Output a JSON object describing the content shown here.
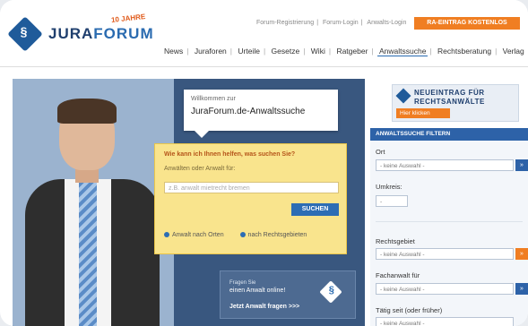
{
  "header": {
    "logo_text_a": "JURA",
    "logo_text_b": "FORUM",
    "logo_mark": "§",
    "logo_badge": "10 JAHRE",
    "top_links": [
      "Forum-Registrierung",
      "Forum-Login",
      "Anwalts-Login"
    ],
    "ra_button": "RA-EINTRAG KOSTENLOS TESTEN",
    "nav": [
      "News",
      "Juraforen",
      "Urteile",
      "Gesetze",
      "Wiki",
      "Ratgeber",
      "Anwaltssuche",
      "Rechtsberatung",
      "Verlag"
    ],
    "nav_active": "Anwaltssuche"
  },
  "hero": {
    "welcome_small": "Willkommen zur",
    "welcome_title": "JuraForum.de-Anwaltssuche",
    "search": {
      "question": "Wie kann ich Ihnen helfen, was suchen Sie?",
      "label": "Anwälten oder Anwalt für:",
      "placeholder": "z.B. anwalt mietrecht bremen",
      "button": "SUCHEN",
      "radio1": "Anwalt nach Orten",
      "radio2": "nach Rechtsgebieten"
    },
    "promo": {
      "line1": "Fragen Sie",
      "line2": "einen Anwalt online!",
      "link": "Jetzt Anwalt fragen >>>"
    }
  },
  "sidebar": {
    "banner_line1": "NEUEINTRAG FÜR",
    "banner_line2": "RECHTSANWÄLTE",
    "banner_button": "Hier klicken",
    "filter_title": "ANWALTSSUCHE FILTERN",
    "fields": {
      "ort_label": "Ort",
      "ort_value": "- keine Auswahl -",
      "umkreis_label": "Umkreis:",
      "umkreis_value": "-",
      "rechtsgebiet_label": "Rechtsgebiet",
      "rechtsgebiet_value": "- keine Auswahl -",
      "fachanwalt_label": "Fachanwalt für",
      "fachanwalt_value": "- keine Auswahl -",
      "taetig_label": "Tätig seit (oder früher)",
      "taetig_value": "- keine Auswahl -"
    },
    "go_glyph": "»"
  },
  "colors": {
    "brand_blue": "#1f5b9a",
    "accent_orange": "#f07e22",
    "hero_dark": "#39577f",
    "search_yellow": "#f9e48d"
  }
}
